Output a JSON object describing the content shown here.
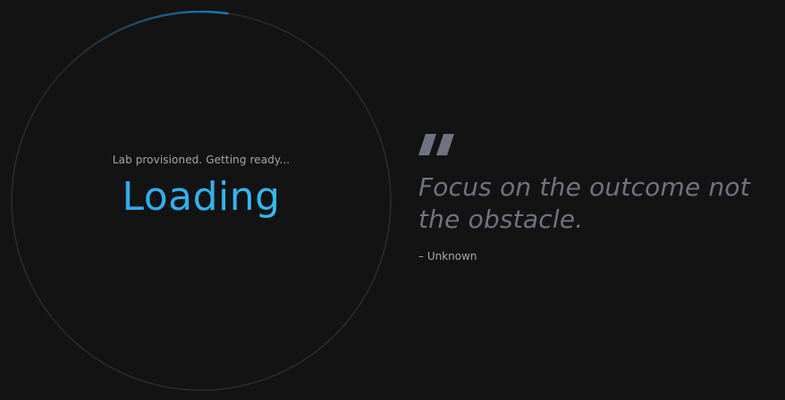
{
  "loader": {
    "status": "Lab provisioned. Getting ready...",
    "title": "Loading",
    "progress": 0.09,
    "track_color": "#2a2b2d",
    "progress_color": "#1b7fc0",
    "title_color": "#37b4f0"
  },
  "quote": {
    "mark_icon": "quote-mark-icon",
    "text": "Focus on the outcome not the obstacle.",
    "author": "– Unknown",
    "text_color": "#6f7381"
  }
}
